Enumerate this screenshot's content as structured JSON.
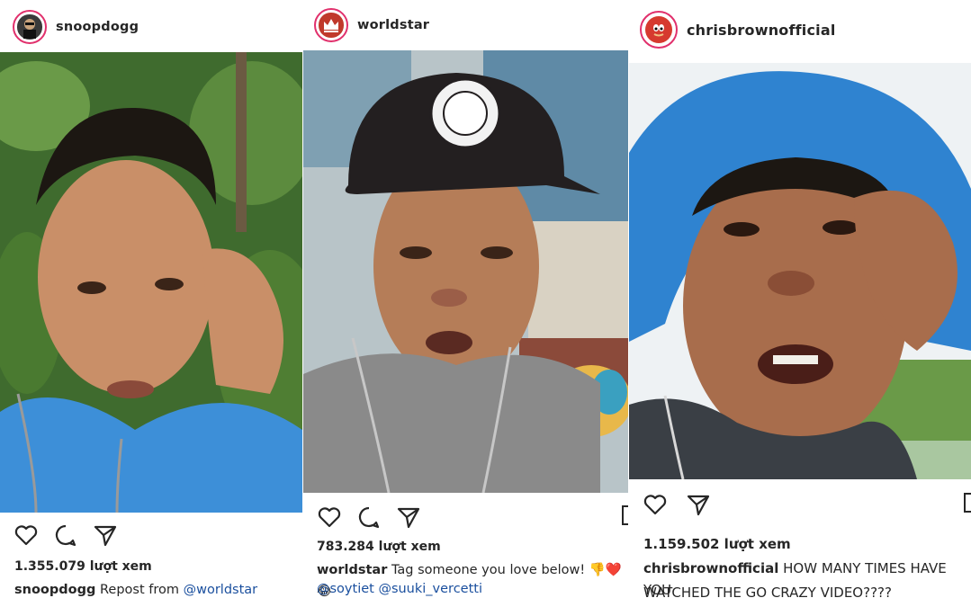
{
  "posts": [
    {
      "username": "snoopdogg",
      "avatar_icon": "snoopdogg-avatar-icon",
      "views": "1.355.079 lượt xem",
      "caption_user": "snoopdogg",
      "caption_text": "Repost from ",
      "caption_mention": "@worldstar",
      "colors": {
        "avatar_bg": "#3a3a3a"
      }
    },
    {
      "username": "worldstar",
      "avatar_icon": "worldstar-crown-icon",
      "views": "783.284 lượt xem",
      "caption_user": "worldstar",
      "caption_text": "Tag someone you love below! 👎❤️😂",
      "mention_1": "@soytiet",
      "mention_2": "@suuki_vercetti",
      "colors": {
        "avatar_bg": "#c0392b"
      }
    },
    {
      "username": "chrisbrownofficial",
      "avatar_icon": "knuckles-avatar-icon",
      "views": "1.159.502 lượt xem",
      "caption_user": "chrisbrownofficial",
      "caption_text": " HOW MANY TIMES HAVE YOU",
      "caption_line2": "WATCHED THE GO CRAZY VIDEO????",
      "colors": {
        "avatar_bg": "#d63a2f"
      }
    }
  ],
  "icons": [
    "heart-icon",
    "comment-icon",
    "share-icon",
    "bookmark-icon"
  ],
  "colors": {
    "mention": "#1a4f9e",
    "text": "#262626",
    "story_ring": "#e1306c"
  }
}
